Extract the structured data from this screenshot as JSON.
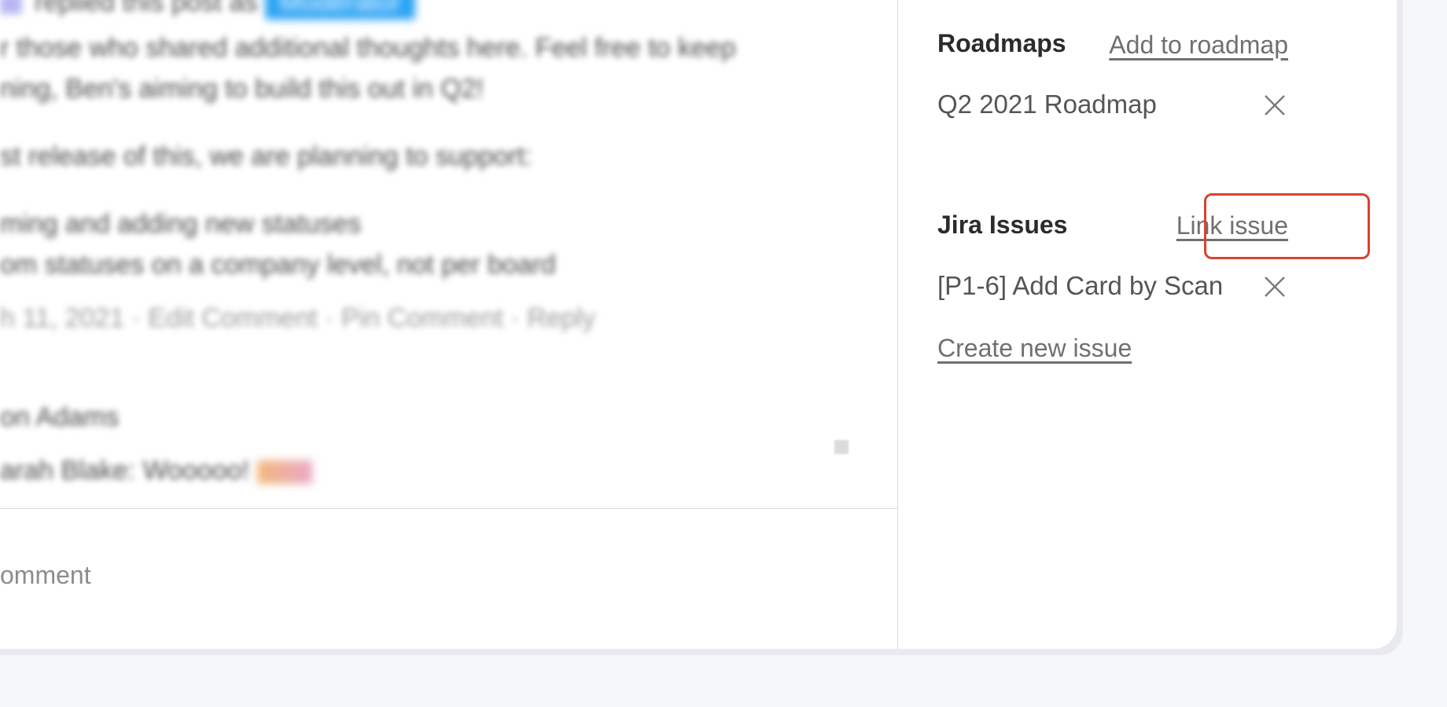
{
  "post": {
    "line_1": "replied this post as",
    "badge": "Moderator",
    "line_2": "r those who shared additional thoughts here. Feel free to keep",
    "line_3": "ning, Ben's aiming to build this out in Q2!",
    "line_4": "st release of this, we are planning to support:",
    "line_5": "ming and adding new statuses",
    "line_6": "om statuses on a company level, not per board",
    "meta": "h 11, 2021 · Edit Comment · Pin Comment · Reply",
    "reply_author": "on Adams",
    "reply_text": "arah Blake: Wooooo!"
  },
  "comment": {
    "placeholder": "omment"
  },
  "sidebar": {
    "roadmaps": {
      "title": "Roadmaps",
      "action": "Add to roadmap",
      "items": [
        {
          "label": "Q2 2021 Roadmap"
        }
      ]
    },
    "jira": {
      "title": "Jira Issues",
      "action": "Link issue",
      "items": [
        {
          "label": "[P1-6] Add Card by Scan"
        }
      ],
      "create_label": "Create new issue"
    }
  },
  "colors": {
    "highlight": "#d8432f",
    "moderator_badge": "#2aa3f4"
  },
  "icons": {
    "remove": "close-icon"
  }
}
